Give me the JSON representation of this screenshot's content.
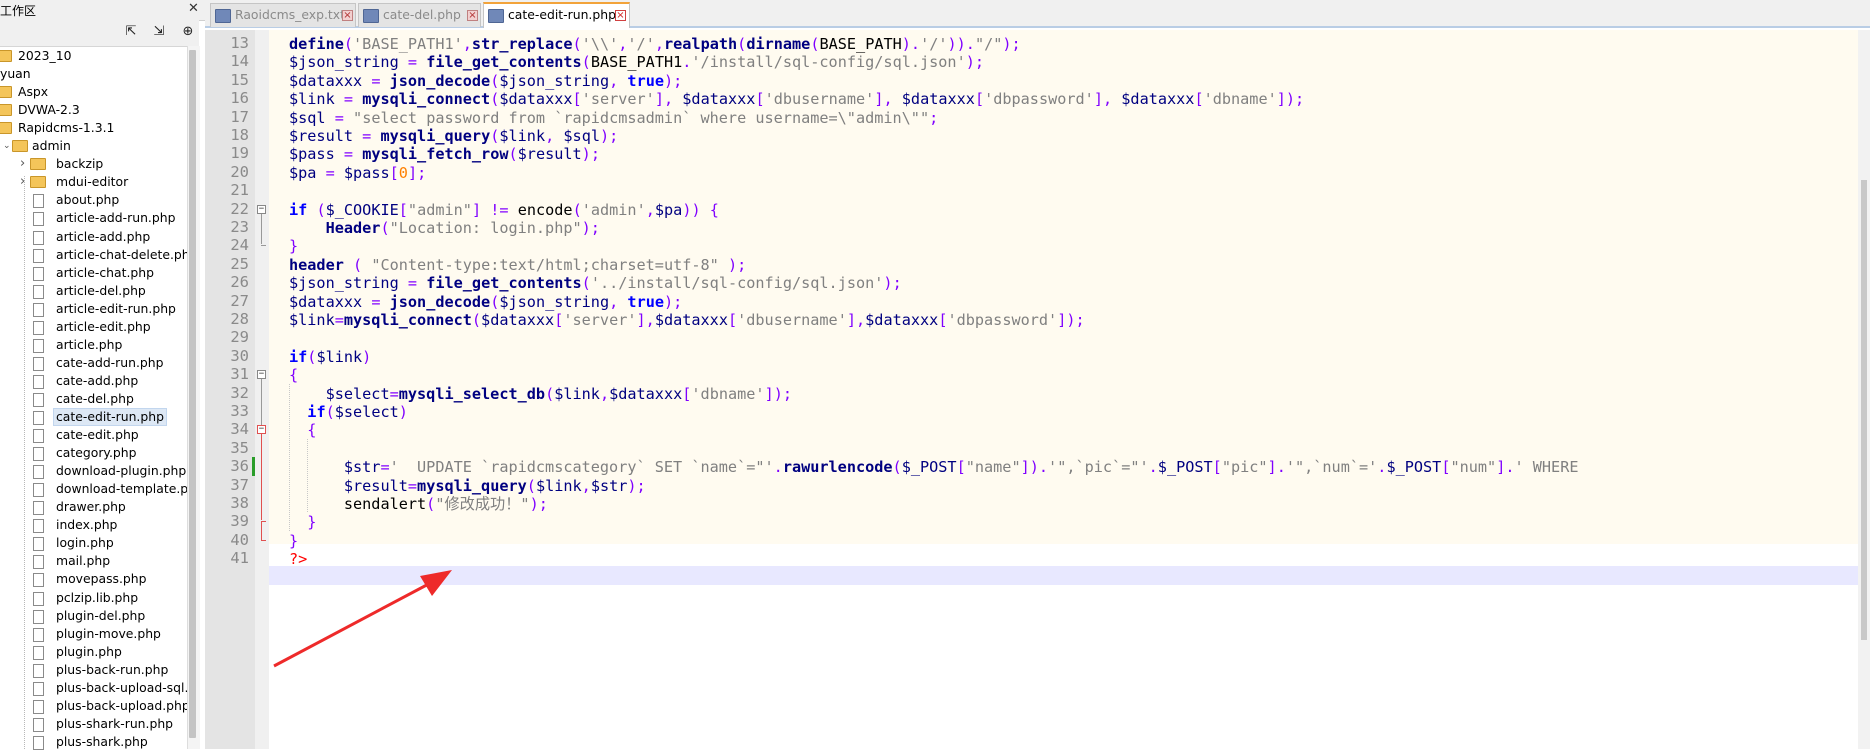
{
  "panel": {
    "title": "工作区",
    "tools": [
      "expand-icon",
      "collapse-icon",
      "locate-icon"
    ],
    "tree": [
      {
        "label": "2023_10",
        "type": "folder"
      },
      {
        "label": "yuan",
        "type": "text"
      },
      {
        "label": "Aspx",
        "type": "folder"
      },
      {
        "label": "DVWA-2.3",
        "type": "folder"
      },
      {
        "label": "Rapidcms-1.3.1",
        "type": "folder"
      },
      {
        "label": "admin",
        "type": "folder"
      },
      {
        "label": "backzip",
        "type": "folder"
      },
      {
        "label": "mdui-editor",
        "type": "folder"
      },
      {
        "label": "about.php",
        "type": "file"
      },
      {
        "label": "article-add-run.php",
        "type": "file"
      },
      {
        "label": "article-add.php",
        "type": "file"
      },
      {
        "label": "article-chat-delete.php",
        "type": "file"
      },
      {
        "label": "article-chat.php",
        "type": "file"
      },
      {
        "label": "article-del.php",
        "type": "file"
      },
      {
        "label": "article-edit-run.php",
        "type": "file"
      },
      {
        "label": "article-edit.php",
        "type": "file"
      },
      {
        "label": "article.php",
        "type": "file"
      },
      {
        "label": "cate-add-run.php",
        "type": "file"
      },
      {
        "label": "cate-add.php",
        "type": "file"
      },
      {
        "label": "cate-del.php",
        "type": "file"
      },
      {
        "label": "cate-edit-run.php",
        "type": "file",
        "selected": true
      },
      {
        "label": "cate-edit.php",
        "type": "file"
      },
      {
        "label": "category.php",
        "type": "file"
      },
      {
        "label": "download-plugin.php",
        "type": "file"
      },
      {
        "label": "download-template.ph",
        "type": "file"
      },
      {
        "label": "drawer.php",
        "type": "file"
      },
      {
        "label": "index.php",
        "type": "file"
      },
      {
        "label": "login.php",
        "type": "file"
      },
      {
        "label": "mail.php",
        "type": "file"
      },
      {
        "label": "movepass.php",
        "type": "file"
      },
      {
        "label": "pclzip.lib.php",
        "type": "file"
      },
      {
        "label": "plugin-del.php",
        "type": "file"
      },
      {
        "label": "plugin-move.php",
        "type": "file"
      },
      {
        "label": "plugin.php",
        "type": "file"
      },
      {
        "label": "plus-back-run.php",
        "type": "file"
      },
      {
        "label": "plus-back-upload-sql.p",
        "type": "file"
      },
      {
        "label": "plus-back-upload.php",
        "type": "file"
      },
      {
        "label": "plus-shark-run.php",
        "type": "file"
      },
      {
        "label": "plus-shark.php",
        "type": "file"
      }
    ]
  },
  "tabs": [
    {
      "label": "Raoidcms_exp.txt",
      "active": false
    },
    {
      "label": "cate-del.php",
      "active": false
    },
    {
      "label": "cate-edit-run.php",
      "active": true
    }
  ],
  "editor": {
    "line_numbers": [
      "13",
      "14",
      "15",
      "16",
      "17",
      "18",
      "19",
      "20",
      "21",
      "22",
      "23",
      "24",
      "25",
      "26",
      "27",
      "28",
      "29",
      "30",
      "31",
      "32",
      "33",
      "34",
      "35",
      "36",
      "37",
      "38",
      "39",
      "40",
      "41"
    ],
    "lines": [
      [
        [
          "fn",
          "define"
        ],
        [
          "op",
          "("
        ],
        [
          "str",
          "'BASE_PATH1'"
        ],
        [
          "op",
          ","
        ],
        [
          "fn",
          "str_replace"
        ],
        [
          "op",
          "("
        ],
        [
          "str",
          "'\\\\'"
        ],
        [
          "op",
          ","
        ],
        [
          "str",
          "'/'"
        ],
        [
          "op",
          ","
        ],
        [
          "fn",
          "realpath"
        ],
        [
          "op",
          "("
        ],
        [
          "fn",
          "dirname"
        ],
        [
          "op",
          "("
        ],
        [
          "plain",
          "BASE_PATH"
        ],
        [
          "op",
          ")."
        ],
        [
          "str",
          "'/'"
        ],
        [
          "op",
          "))."
        ],
        [
          "str",
          "\"/\""
        ],
        [
          "op",
          ");"
        ]
      ],
      [
        [
          "var",
          "$json_string"
        ],
        [
          "plain",
          " "
        ],
        [
          "op",
          "="
        ],
        [
          "plain",
          " "
        ],
        [
          "fn",
          "file_get_contents"
        ],
        [
          "op",
          "("
        ],
        [
          "plain",
          "BASE_PATH1"
        ],
        [
          "op",
          "."
        ],
        [
          "str",
          "'/install/sql-config/sql.json'"
        ],
        [
          "op",
          ");"
        ]
      ],
      [
        [
          "var",
          "$dataxxx"
        ],
        [
          "plain",
          " "
        ],
        [
          "op",
          "="
        ],
        [
          "plain",
          " "
        ],
        [
          "fn",
          "json_decode"
        ],
        [
          "op",
          "("
        ],
        [
          "var",
          "$json_string"
        ],
        [
          "op",
          ","
        ],
        [
          "plain",
          " "
        ],
        [
          "kw",
          "true"
        ],
        [
          "op",
          ");"
        ]
      ],
      [
        [
          "var",
          "$link"
        ],
        [
          "plain",
          " "
        ],
        [
          "op",
          "="
        ],
        [
          "plain",
          " "
        ],
        [
          "fn",
          "mysqli_connect"
        ],
        [
          "op",
          "("
        ],
        [
          "var",
          "$dataxxx"
        ],
        [
          "op",
          "["
        ],
        [
          "str",
          "'server'"
        ],
        [
          "op",
          "],"
        ],
        [
          "plain",
          " "
        ],
        [
          "var",
          "$dataxxx"
        ],
        [
          "op",
          "["
        ],
        [
          "str",
          "'dbusername'"
        ],
        [
          "op",
          "],"
        ],
        [
          "plain",
          " "
        ],
        [
          "var",
          "$dataxxx"
        ],
        [
          "op",
          "["
        ],
        [
          "str",
          "'dbpassword'"
        ],
        [
          "op",
          "],"
        ],
        [
          "plain",
          " "
        ],
        [
          "var",
          "$dataxxx"
        ],
        [
          "op",
          "["
        ],
        [
          "str",
          "'dbname'"
        ],
        [
          "op",
          "]);"
        ]
      ],
      [
        [
          "var",
          "$sql"
        ],
        [
          "plain",
          " "
        ],
        [
          "op",
          "="
        ],
        [
          "plain",
          " "
        ],
        [
          "str",
          "\"select password from `rapidcmsadmin` where username=\\\"admin\\\"\""
        ],
        [
          "op",
          ";"
        ]
      ],
      [
        [
          "var",
          "$result"
        ],
        [
          "plain",
          " "
        ],
        [
          "op",
          "="
        ],
        [
          "plain",
          " "
        ],
        [
          "fn",
          "mysqli_query"
        ],
        [
          "op",
          "("
        ],
        [
          "var",
          "$link"
        ],
        [
          "op",
          ","
        ],
        [
          "plain",
          " "
        ],
        [
          "var",
          "$sql"
        ],
        [
          "op",
          ");"
        ]
      ],
      [
        [
          "var",
          "$pass"
        ],
        [
          "plain",
          " "
        ],
        [
          "op",
          "="
        ],
        [
          "plain",
          " "
        ],
        [
          "fn",
          "mysqli_fetch_row"
        ],
        [
          "op",
          "("
        ],
        [
          "var",
          "$result"
        ],
        [
          "op",
          ");"
        ]
      ],
      [
        [
          "var",
          "$pa"
        ],
        [
          "plain",
          " "
        ],
        [
          "op",
          "="
        ],
        [
          "plain",
          " "
        ],
        [
          "var",
          "$pass"
        ],
        [
          "op",
          "["
        ],
        [
          "num",
          "0"
        ],
        [
          "op",
          "];"
        ]
      ],
      [],
      [
        [
          "kw",
          "if"
        ],
        [
          "plain",
          " "
        ],
        [
          "op",
          "("
        ],
        [
          "var",
          "$_COOKIE"
        ],
        [
          "op",
          "["
        ],
        [
          "str",
          "\"admin\""
        ],
        [
          "op",
          "]"
        ],
        [
          "plain",
          " "
        ],
        [
          "op",
          "!="
        ],
        [
          "plain",
          " encode"
        ],
        [
          "op",
          "("
        ],
        [
          "str",
          "'admin'"
        ],
        [
          "op",
          ","
        ],
        [
          "var",
          "$pa"
        ],
        [
          "op",
          "))"
        ],
        [
          "plain",
          " "
        ],
        [
          "op",
          "{"
        ]
      ],
      [
        [
          "plain",
          "    "
        ],
        [
          "fn",
          "Header"
        ],
        [
          "op",
          "("
        ],
        [
          "str",
          "\"Location: login.php\""
        ],
        [
          "op",
          ");"
        ]
      ],
      [
        [
          "op",
          "}"
        ]
      ],
      [
        [
          "fn",
          "header"
        ],
        [
          "plain",
          " "
        ],
        [
          "op",
          "("
        ],
        [
          "plain",
          " "
        ],
        [
          "str",
          "\"Content-type:text/html;charset=utf-8\""
        ],
        [
          "plain",
          " "
        ],
        [
          "op",
          ");"
        ]
      ],
      [
        [
          "var",
          "$json_string"
        ],
        [
          "plain",
          " "
        ],
        [
          "op",
          "="
        ],
        [
          "plain",
          " "
        ],
        [
          "fn",
          "file_get_contents"
        ],
        [
          "op",
          "("
        ],
        [
          "str",
          "'../install/sql-config/sql.json'"
        ],
        [
          "op",
          ");"
        ]
      ],
      [
        [
          "var",
          "$dataxxx"
        ],
        [
          "plain",
          " "
        ],
        [
          "op",
          "="
        ],
        [
          "plain",
          " "
        ],
        [
          "fn",
          "json_decode"
        ],
        [
          "op",
          "("
        ],
        [
          "var",
          "$json_string"
        ],
        [
          "op",
          ","
        ],
        [
          "plain",
          " "
        ],
        [
          "kw",
          "true"
        ],
        [
          "op",
          ");"
        ]
      ],
      [
        [
          "var",
          "$link"
        ],
        [
          "op",
          "="
        ],
        [
          "fn",
          "mysqli_connect"
        ],
        [
          "op",
          "("
        ],
        [
          "var",
          "$dataxxx"
        ],
        [
          "op",
          "["
        ],
        [
          "str",
          "'server'"
        ],
        [
          "op",
          "],"
        ],
        [
          "var",
          "$dataxxx"
        ],
        [
          "op",
          "["
        ],
        [
          "str",
          "'dbusername'"
        ],
        [
          "op",
          "],"
        ],
        [
          "var",
          "$dataxxx"
        ],
        [
          "op",
          "["
        ],
        [
          "str",
          "'dbpassword'"
        ],
        [
          "op",
          "]);"
        ]
      ],
      [],
      [
        [
          "kw",
          "if"
        ],
        [
          "op",
          "("
        ],
        [
          "var",
          "$link"
        ],
        [
          "op",
          ")"
        ]
      ],
      [
        [
          "op",
          "{"
        ]
      ],
      [
        [
          "plain",
          "    "
        ],
        [
          "var",
          "$select"
        ],
        [
          "op",
          "="
        ],
        [
          "fn",
          "mysqli_select_db"
        ],
        [
          "op",
          "("
        ],
        [
          "var",
          "$link"
        ],
        [
          "op",
          ","
        ],
        [
          "var",
          "$dataxxx"
        ],
        [
          "op",
          "["
        ],
        [
          "str",
          "'dbname'"
        ],
        [
          "op",
          "]);"
        ]
      ],
      [
        [
          "plain",
          "  "
        ],
        [
          "kw",
          "if"
        ],
        [
          "op",
          "("
        ],
        [
          "var",
          "$select"
        ],
        [
          "op",
          ")"
        ]
      ],
      [
        [
          "plain",
          "  "
        ],
        [
          "op",
          "{"
        ]
      ],
      [],
      [
        [
          "plain",
          "      "
        ],
        [
          "var",
          "$str"
        ],
        [
          "op",
          "="
        ],
        [
          "str",
          "'  UPDATE `rapidcmscategory` SET `name`=\"'"
        ],
        [
          "op",
          "."
        ],
        [
          "fn",
          "rawurlencode"
        ],
        [
          "op",
          "("
        ],
        [
          "var",
          "$_POST"
        ],
        [
          "op",
          "["
        ],
        [
          "str",
          "\"name\""
        ],
        [
          "op",
          "])."
        ],
        [
          "str",
          "'\",`pic`=\"'"
        ],
        [
          "op",
          "."
        ],
        [
          "var",
          "$_POST"
        ],
        [
          "op",
          "["
        ],
        [
          "str",
          "\"pic\""
        ],
        [
          "op",
          "]."
        ],
        [
          "str",
          "'\",`num`='"
        ],
        [
          "op",
          "."
        ],
        [
          "var",
          "$_POST"
        ],
        [
          "op",
          "["
        ],
        [
          "str",
          "\"num\""
        ],
        [
          "op",
          "]."
        ],
        [
          "str",
          "' WHERE"
        ]
      ],
      [
        [
          "plain",
          "      "
        ],
        [
          "var",
          "$result"
        ],
        [
          "op",
          "="
        ],
        [
          "fn",
          "mysqli_query"
        ],
        [
          "op",
          "("
        ],
        [
          "var",
          "$link"
        ],
        [
          "op",
          ","
        ],
        [
          "var",
          "$str"
        ],
        [
          "op",
          ");"
        ]
      ],
      [
        [
          "plain",
          "      "
        ],
        [
          "plain",
          "sendalert"
        ],
        [
          "op",
          "("
        ],
        [
          "str",
          "\"修改成功！\""
        ],
        [
          "op",
          ");"
        ]
      ],
      [
        [
          "plain",
          "  "
        ],
        [
          "op",
          "}"
        ]
      ],
      [
        [
          "op",
          "}"
        ]
      ],
      [
        [
          "php",
          "?>"
        ]
      ]
    ]
  }
}
